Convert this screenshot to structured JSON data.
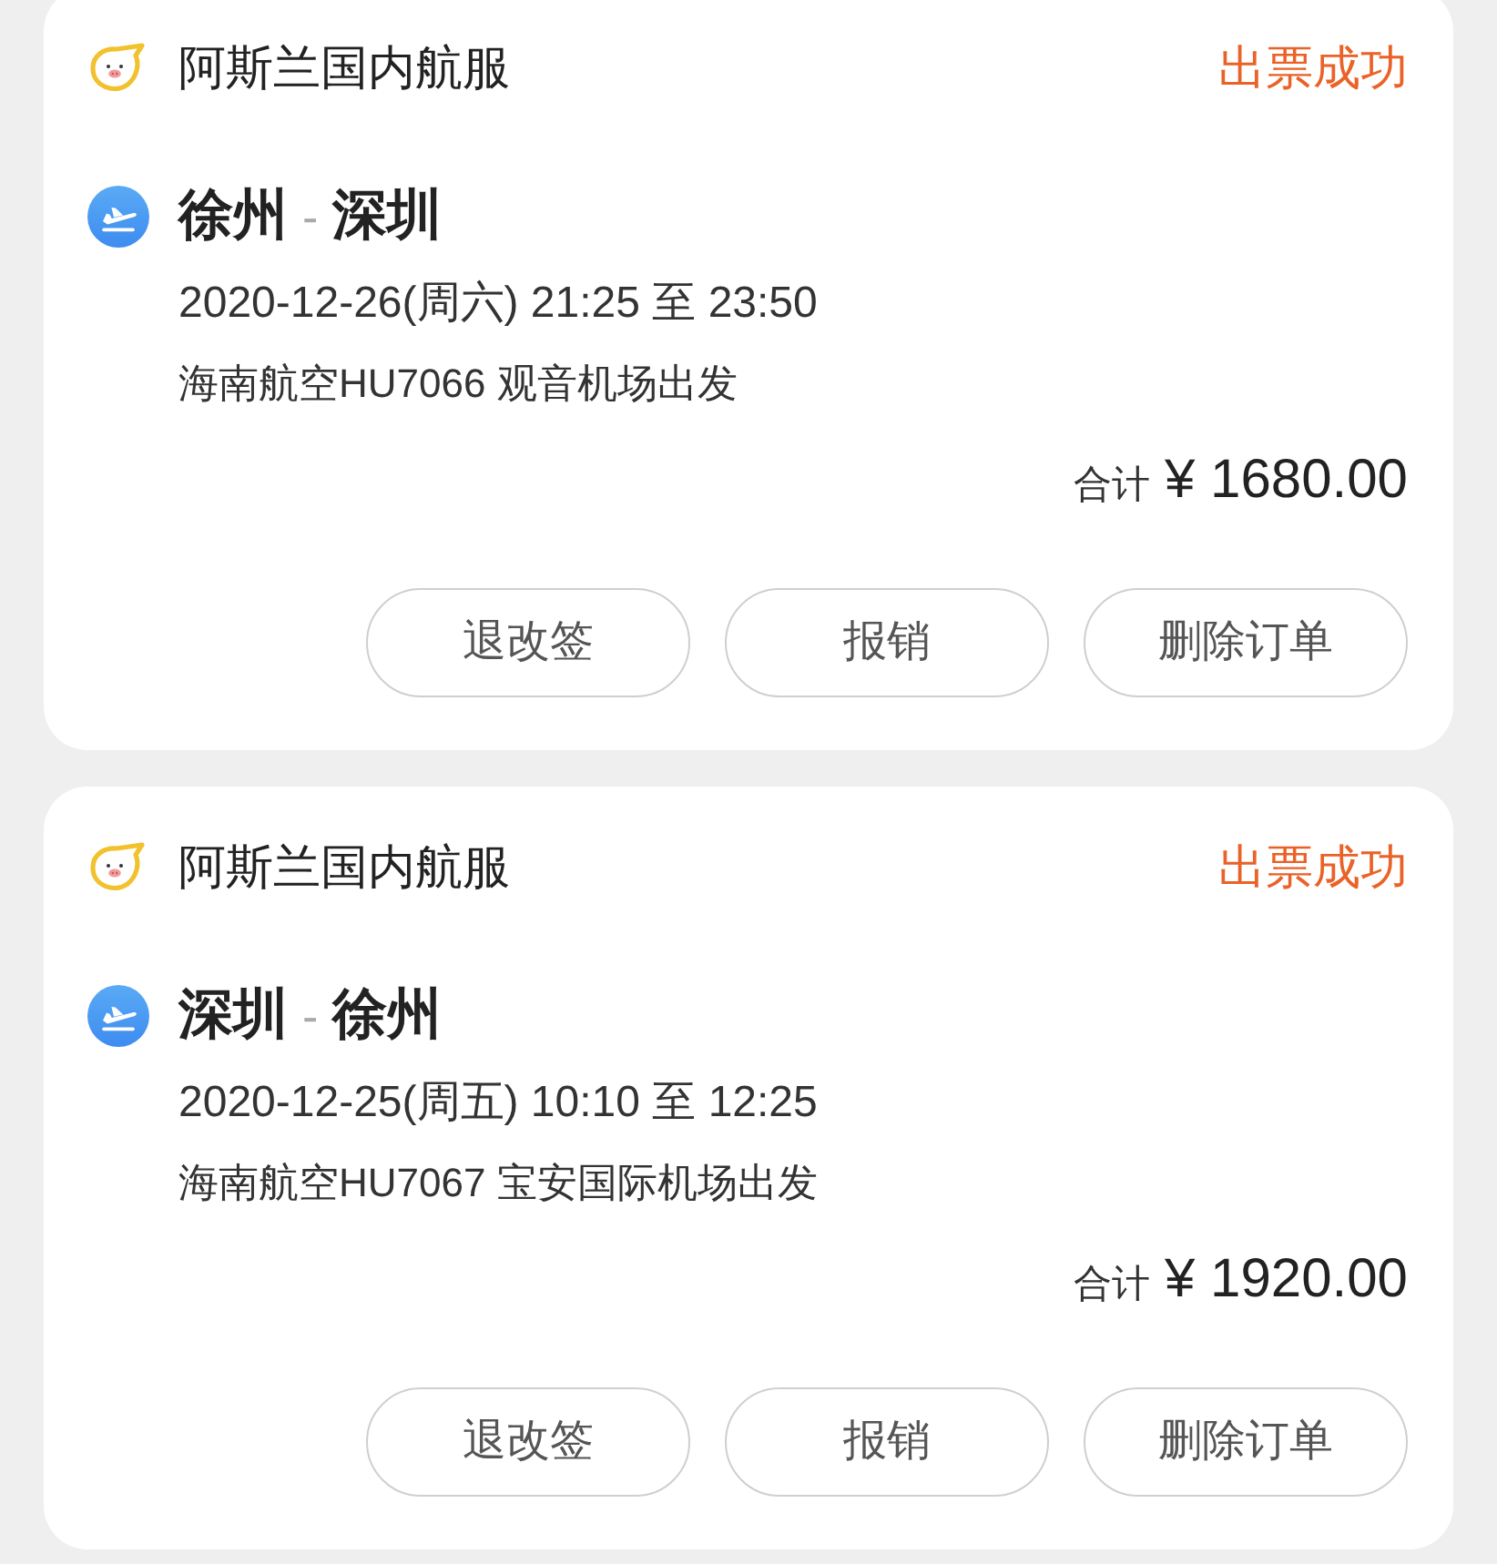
{
  "orders": [
    {
      "merchant": "阿斯兰国内航服",
      "status": "出票成功",
      "route": {
        "from": "徐州",
        "separator": "-",
        "to": "深圳"
      },
      "schedule": "2020-12-26(周六) 21:25 至 23:50",
      "flight": "海南航空HU7066 观音机场出发",
      "total_label": "合计",
      "total": "¥ 1680.00",
      "actions": [
        "退改签",
        "报销",
        "删除订单"
      ]
    },
    {
      "merchant": "阿斯兰国内航服",
      "status": "出票成功",
      "route": {
        "from": "深圳",
        "separator": "-",
        "to": "徐州"
      },
      "schedule": "2020-12-25(周五) 10:10 至 12:25",
      "flight": "海南航空HU7067 宝安国际机场出发",
      "total_label": "合计",
      "total": "¥ 1920.00",
      "actions": [
        "退改签",
        "报销",
        "删除订单"
      ]
    }
  ]
}
